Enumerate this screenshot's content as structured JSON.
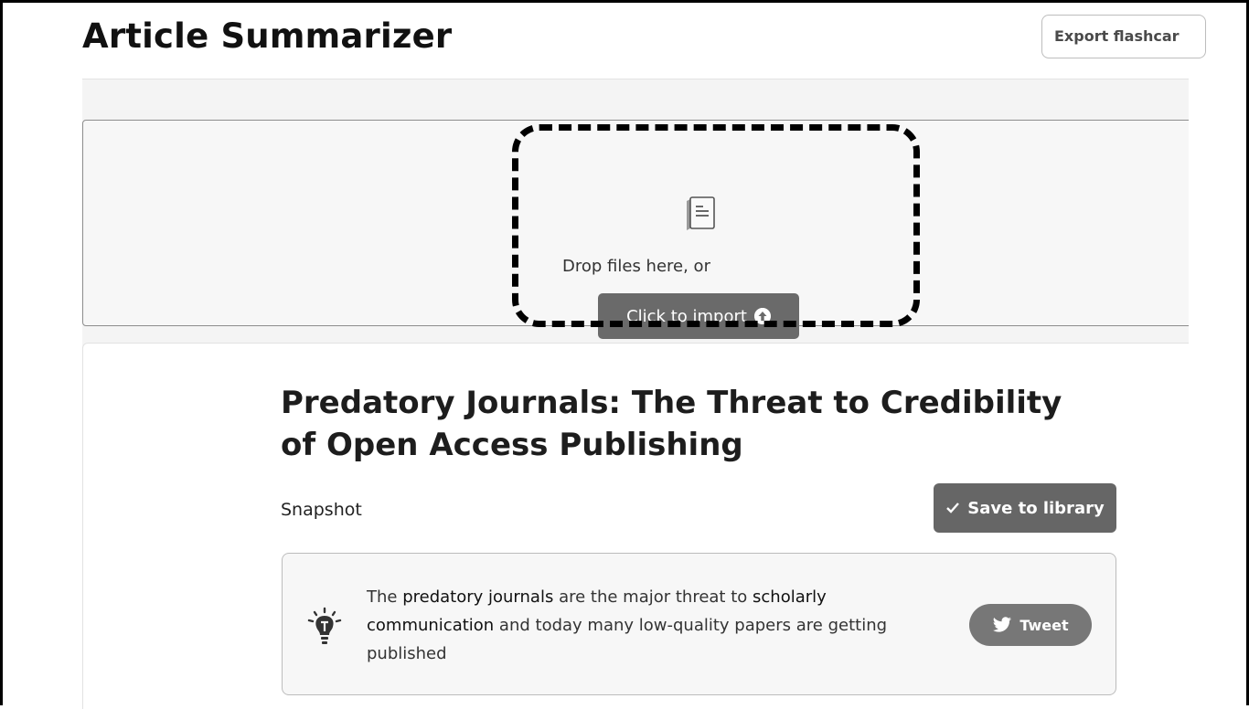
{
  "header": {
    "title": "Article Summarizer",
    "export_label": "Export flashcar"
  },
  "dropzone": {
    "icon": "document-icon",
    "hint": "Drop files here, or",
    "import_label": "Click to import",
    "import_icon": "upload-circle-icon"
  },
  "article": {
    "title": "Predatory Journals: The Threat to Credibility of Open Access Publishing",
    "subheading": "Snapshot",
    "save_label": "Save to library",
    "save_icon": "check-icon",
    "highlight": {
      "icon": "lightbulb-icon",
      "segments": [
        {
          "text": "The ",
          "emphasis": false
        },
        {
          "text": "predatory journals",
          "emphasis": true
        },
        {
          "text": " are the major threat to ",
          "emphasis": false
        },
        {
          "text": "scholarly communication",
          "emphasis": true
        },
        {
          "text": " and today many low-quality papers are getting published",
          "emphasis": false
        }
      ],
      "tweet_label": "Tweet",
      "tweet_icon": "twitter-bird-icon"
    }
  },
  "colors": {
    "button_fill": "#666666",
    "dashed_outline": "#000000"
  }
}
